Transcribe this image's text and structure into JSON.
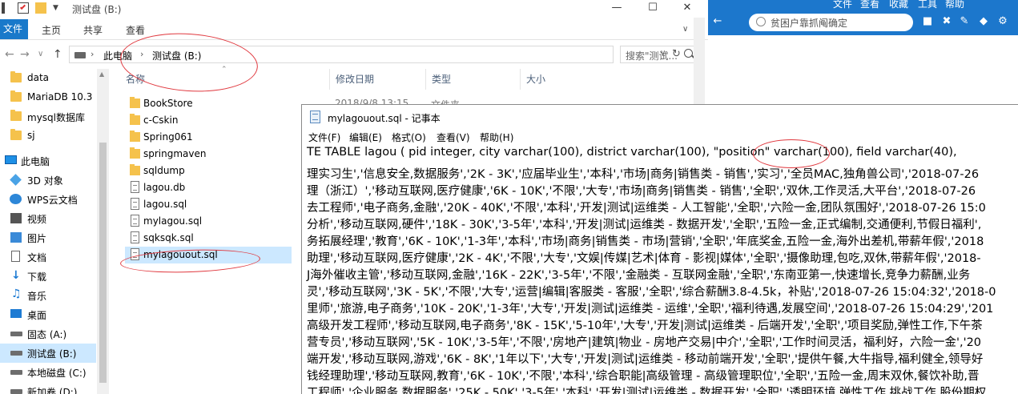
{
  "explorer": {
    "title": "测试盘 (B:)",
    "window_buttons": [
      "—",
      "☐",
      "✕"
    ],
    "ribbon_tabs": [
      "文件",
      "主页",
      "共享",
      "查看"
    ],
    "address": {
      "crumbs": [
        "此电脑",
        "测试盘 (B:)"
      ]
    },
    "search": {
      "placeholder": "搜索\"测试..."
    },
    "nav": [
      {
        "label": "data",
        "icon": "folder-icon"
      },
      {
        "label": "MariaDB 10.3",
        "icon": "folder-icon"
      },
      {
        "label": "mysql数据库",
        "icon": "folder-icon"
      },
      {
        "label": "sj",
        "icon": "folder-icon"
      },
      {
        "label": "此电脑",
        "icon": "this-pc-icon"
      },
      {
        "label": "3D 对象",
        "icon": "3d-objects-icon"
      },
      {
        "label": "WPS云文档",
        "icon": "cloud-icon"
      },
      {
        "label": "视频",
        "icon": "video-icon"
      },
      {
        "label": "图片",
        "icon": "pictures-icon"
      },
      {
        "label": "文档",
        "icon": "documents-icon"
      },
      {
        "label": "下载",
        "icon": "download-icon"
      },
      {
        "label": "音乐",
        "icon": "music-icon"
      },
      {
        "label": "桌面",
        "icon": "desktop-icon"
      },
      {
        "label": "固态 (A:)",
        "icon": "drive-icon"
      },
      {
        "label": "测试盘 (B:)",
        "icon": "drive-icon"
      },
      {
        "label": "本地磁盘 (C:)",
        "icon": "drive-icon"
      },
      {
        "label": "新加卷 (D:)",
        "icon": "drive-icon"
      }
    ],
    "columns": [
      "名称",
      "修改日期",
      "类型",
      "大小"
    ],
    "files": [
      {
        "name": "BookStore",
        "kind": "folder"
      },
      {
        "name": "c-Cskin",
        "kind": "folder"
      },
      {
        "name": "Spring061",
        "kind": "folder"
      },
      {
        "name": "springmaven",
        "kind": "folder"
      },
      {
        "name": "sqldump",
        "kind": "folder"
      },
      {
        "name": "lagou.db",
        "kind": "file"
      },
      {
        "name": "lagou.sql",
        "kind": "file"
      },
      {
        "name": "mylagou.sql",
        "kind": "file"
      },
      {
        "name": "sqksqk.sql",
        "kind": "file"
      },
      {
        "name": "mylagouout.sql",
        "kind": "file"
      }
    ],
    "first_row_date": "2018/9/8 13:15",
    "first_row_type": "文件夹"
  },
  "background_app": {
    "menu": [
      "文件",
      "查看",
      "收藏",
      "工具",
      "帮助"
    ],
    "search_text": "贫困户靠抓阄确定"
  },
  "notepad": {
    "title": "mylagouout.sql - 记事本",
    "menu": [
      "文件(F)",
      "编辑(E)",
      "格式(O)",
      "查看(V)",
      "帮助(H)"
    ],
    "lines": [
      "TE TABLE lagou (    pid integer,     city varchar(100),     district varchar(100),     \"position\" varchar(100),     field varchar(40),",
      "理实习生','信息安全,数据服务','2K - 3K','应届毕业生','本科','市场|商务|销售类 - 销售','实习','全员MAC,独角兽公司','2018-07-26",
      "理（浙江）','移动互联网,医疗健康','6K - 10K','不限','大专','市场|商务|销售类 - 销售','全职','双休,工作灵活,大平台','2018-07-26",
      "去工程师','电子商务,金融','20K - 40K','不限','本科','开发|测试|运维类 - 人工智能','全职','六险一金,团队氛围好','2018-07-26 15:0",
      "分析','移动互联网,硬件','18K - 30K','3-5年','本科','开发|测试|运维类 - 数据开发','全职','五险一金,正式编制,交通便利,节假日福利',",
      "务拓展经理','教育','6K - 10K','1-3年','本科','市场|商务|销售类 - 市场|营销','全职','年底奖金,五险一金,海外出差机,带薪年假','2018",
      "助理','移动互联网,医疗健康','2K - 4K','不限','大专','文娱|传媒|艺术|体育 - 影视|媒体','全职','摄像助理,包吃,双休,带薪年假','2018-",
      "J海外催收主管','移动互联网,金融','16K - 22K','3-5年','不限','金融类 - 互联网金融','全职','东南亚第一,快速增长,竞争力薪酬,业务",
      "灵','移动互联网','3K - 5K','不限','大专','运营|编辑|客服类 - 客服','全职','综合薪酬3.8-4.5k，补贴','2018-07-26 15:04:32','2018-0",
      "里师','旅游,电子商务','10K - 20K','1-3年','大专','开发|测试|运维类 - 运维','全职','福利待遇,发展空间','2018-07-26 15:04:29','201",
      "高级开发工程师','移动互联网,电子商务','8K - 15K','5-10年','大专','开发|测试|运维类 - 后端开发','全职','项目奖励,弹性工作,下午茶",
      "营专员','移动互联网','5K - 10K','3-5年','不限','房地产|建筑|物业 - 房地产交易|中介','全职','工作时间灵活，福利好，六险一金','20",
      "端开发','移动互联网,游戏','6K - 8K','1年以下','大专','开发|测试|运维类 - 移动前端开发','全职','提供午餐,大牛指导,福利健全,领导好",
      "钱经理助理','移动互联网,教育','6K - 10K','不限','本科','综合职能|高级管理 - 高级管理职位','全职','五险一金,周末双休,餐饮补助,晋",
      "工程师','企业服务,数据服务','25K - 50K','3-5年','本科','开发|测试|运维类 - 数据开发','全职','透明环境,弹性工作,挑战工作,股份期权"
    ]
  }
}
